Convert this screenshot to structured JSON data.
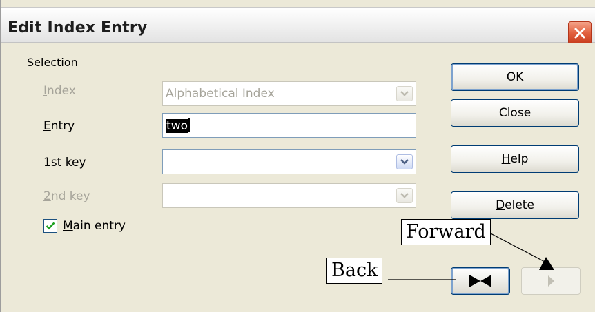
{
  "window": {
    "title": "Edit Index Entry",
    "close_icon": "close-icon"
  },
  "selection": {
    "group_label": "Selection",
    "rows": [
      {
        "label": "Index",
        "mnemonic": "I",
        "value": "Alphabetical Index",
        "enabled": false
      },
      {
        "label": "Entry",
        "mnemonic": "E",
        "value": "two",
        "enabled": true
      },
      {
        "label": "1st key",
        "mnemonic": "1",
        "value": "",
        "enabled": true
      },
      {
        "label": "2nd key",
        "mnemonic": "2",
        "value": "",
        "enabled": false
      }
    ],
    "main_entry": {
      "label": "Main entry",
      "mnemonic": "M",
      "checked": true
    }
  },
  "buttons": {
    "ok": "OK",
    "close": "Close",
    "help": "Help",
    "delete": "Delete"
  },
  "annotations": {
    "forward": "Forward",
    "back": "Back"
  },
  "colors": {
    "dialog_bg": "#ece9d8",
    "button_border": "#003c74",
    "disabled_text": "#a6a49a",
    "close_red": "#e2603f"
  }
}
